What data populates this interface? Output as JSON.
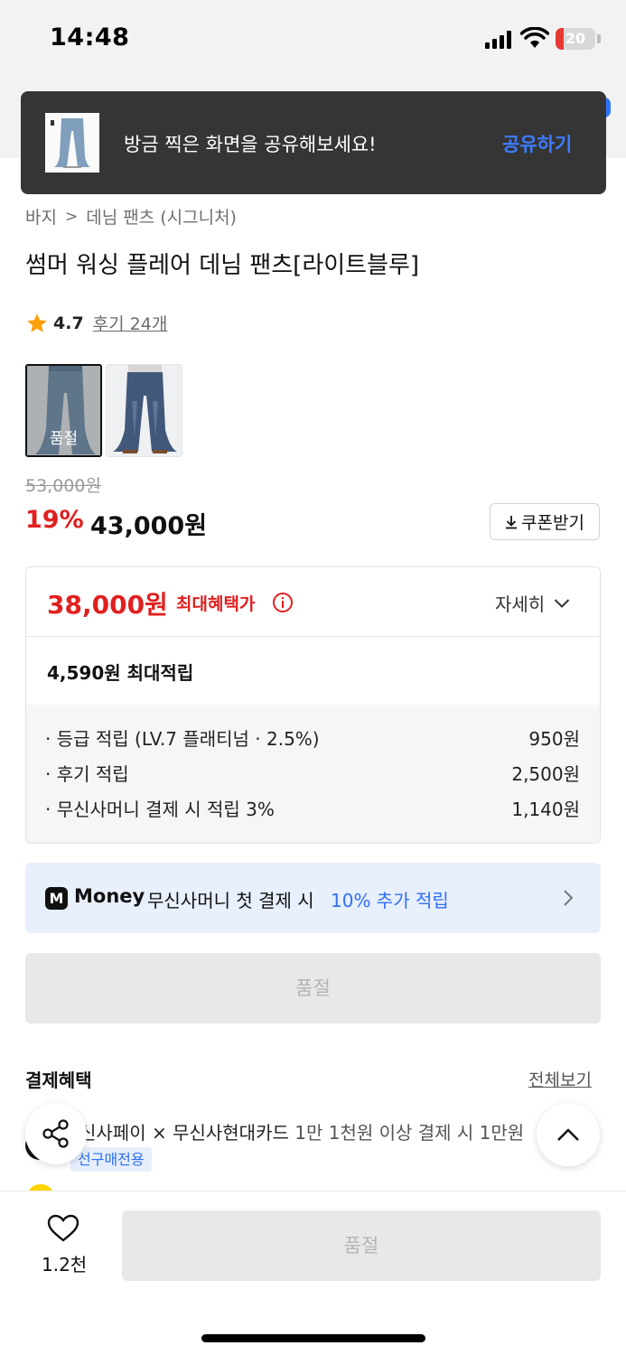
{
  "status_bar": {
    "time": "14:48",
    "battery": "20",
    "battery_level": 0.2
  },
  "toast": {
    "message": "방금 찍은 화면을 공유해보세요!",
    "action": "공유하기"
  },
  "breadcrumb": {
    "category": "바지",
    "sub_category": "데님 팬츠 (시그니처)"
  },
  "product": {
    "title": "썸머 워싱 플레어 데님 팬츠[라이트블루]",
    "rating": "4.7",
    "review_link": "후기 24개",
    "swatch_soldout_label": "품절"
  },
  "price": {
    "original": "53,000원",
    "discount_rate": "19%",
    "sale": "43,000원",
    "coupon_button": "쿠폰받기"
  },
  "benefits": {
    "max_price": "38,000원",
    "max_price_label": "최대혜택가",
    "detail_toggle": "자세히",
    "max_points": "4,590원 최대적립",
    "rows": [
      {
        "label": "· 등급 적립 (LV.7 플래티넘 · 2.5%)",
        "amount": "950원"
      },
      {
        "label": "· 후기 적립",
        "amount": "2,500원"
      },
      {
        "label": "· 무신사머니 결제 시 적립 3%",
        "amount": "1,140원"
      }
    ]
  },
  "money_banner": {
    "logo_letter": "M",
    "brand": "Money",
    "text": "무신사머니 첫 결제 시",
    "highlight": "10% 추가 적립"
  },
  "soldout_button": "품절",
  "payment": {
    "title": "결제혜택",
    "view_all": "전체보기",
    "line_main": "신사페이 × 무신사현대카드",
    "line_detail": "1만 1천원 이상 결제 시 1만원",
    "tag": "선구매전용"
  },
  "bottom": {
    "like_count": "1.2천",
    "soldout_label": "품절"
  },
  "colors": {
    "accent_red": "#e02020",
    "accent_blue": "#2d6ff2",
    "toast_bg": "#353535"
  }
}
